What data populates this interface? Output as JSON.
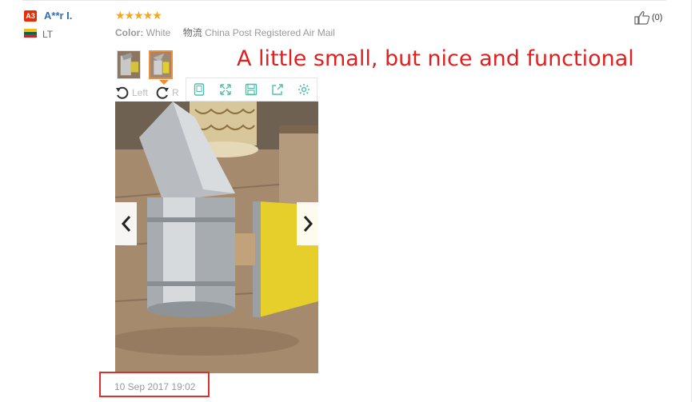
{
  "reviewer": {
    "level_badge": "A3",
    "name": "A**r I.",
    "country_code": "LT",
    "flag_colors": [
      "#fdb913",
      "#006a44",
      "#c1272d"
    ]
  },
  "rating": {
    "stars": "★★★★★",
    "value": 5,
    "max": 5
  },
  "meta": {
    "color_label": "Color:",
    "color_value": "White",
    "logistics_label": "物流",
    "logistics_value": "China Post Registered Air Mail"
  },
  "helpful": {
    "count": "(0)"
  },
  "annotation": "A little small, but nice and functional",
  "viewer": {
    "rotate_left_label": "Left",
    "rotate_right_label": "R",
    "toolbar_icons": [
      "tablet-icon",
      "fullscreen-icon",
      "save-icon",
      "share-icon",
      "settings-icon"
    ],
    "toolbar_color": "#4fc0a8",
    "thumbnails": [
      "thumbnail-1",
      "thumbnail-2"
    ]
  },
  "review_date": "10 Sep 2017 19:02",
  "colors": {
    "annotation": "#e02020",
    "highlight_box": "#d93030",
    "accent_orange": "#f08d3c",
    "link_blue": "#2f6fb5",
    "star": "#f5a623"
  }
}
